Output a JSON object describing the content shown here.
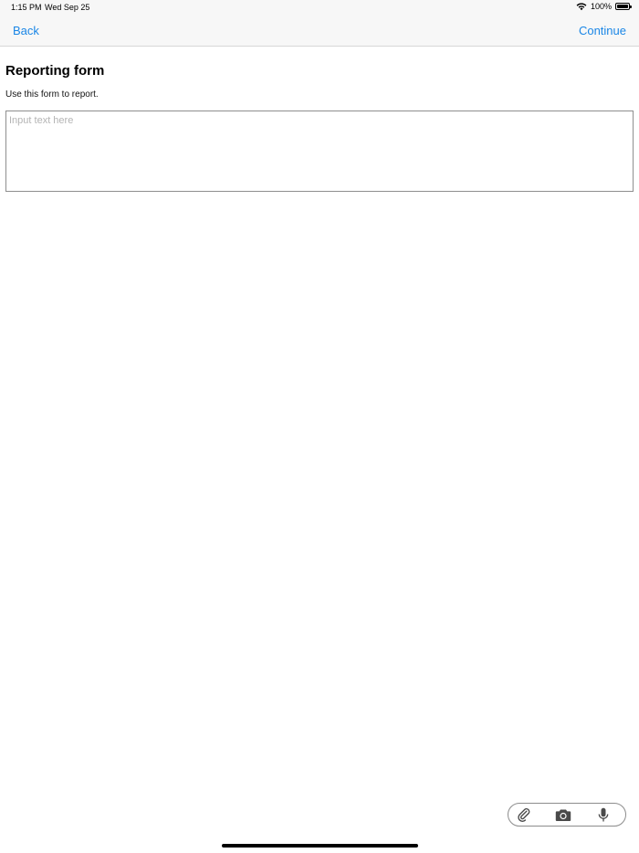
{
  "status_bar": {
    "time": "1:15 PM",
    "date": "Wed Sep 25",
    "battery": "100%"
  },
  "nav": {
    "back_label": "Back",
    "continue_label": "Continue"
  },
  "form": {
    "title": "Reporting form",
    "description": "Use this form to report.",
    "input_placeholder": "Input text here",
    "input_value": ""
  },
  "toolbar": {
    "icons": [
      "paperclip-icon",
      "camera-icon",
      "microphone-icon"
    ]
  },
  "colors": {
    "accent": "#1a86e6",
    "bar_background": "#f7f7f7",
    "placeholder": "#b4b4b4"
  }
}
